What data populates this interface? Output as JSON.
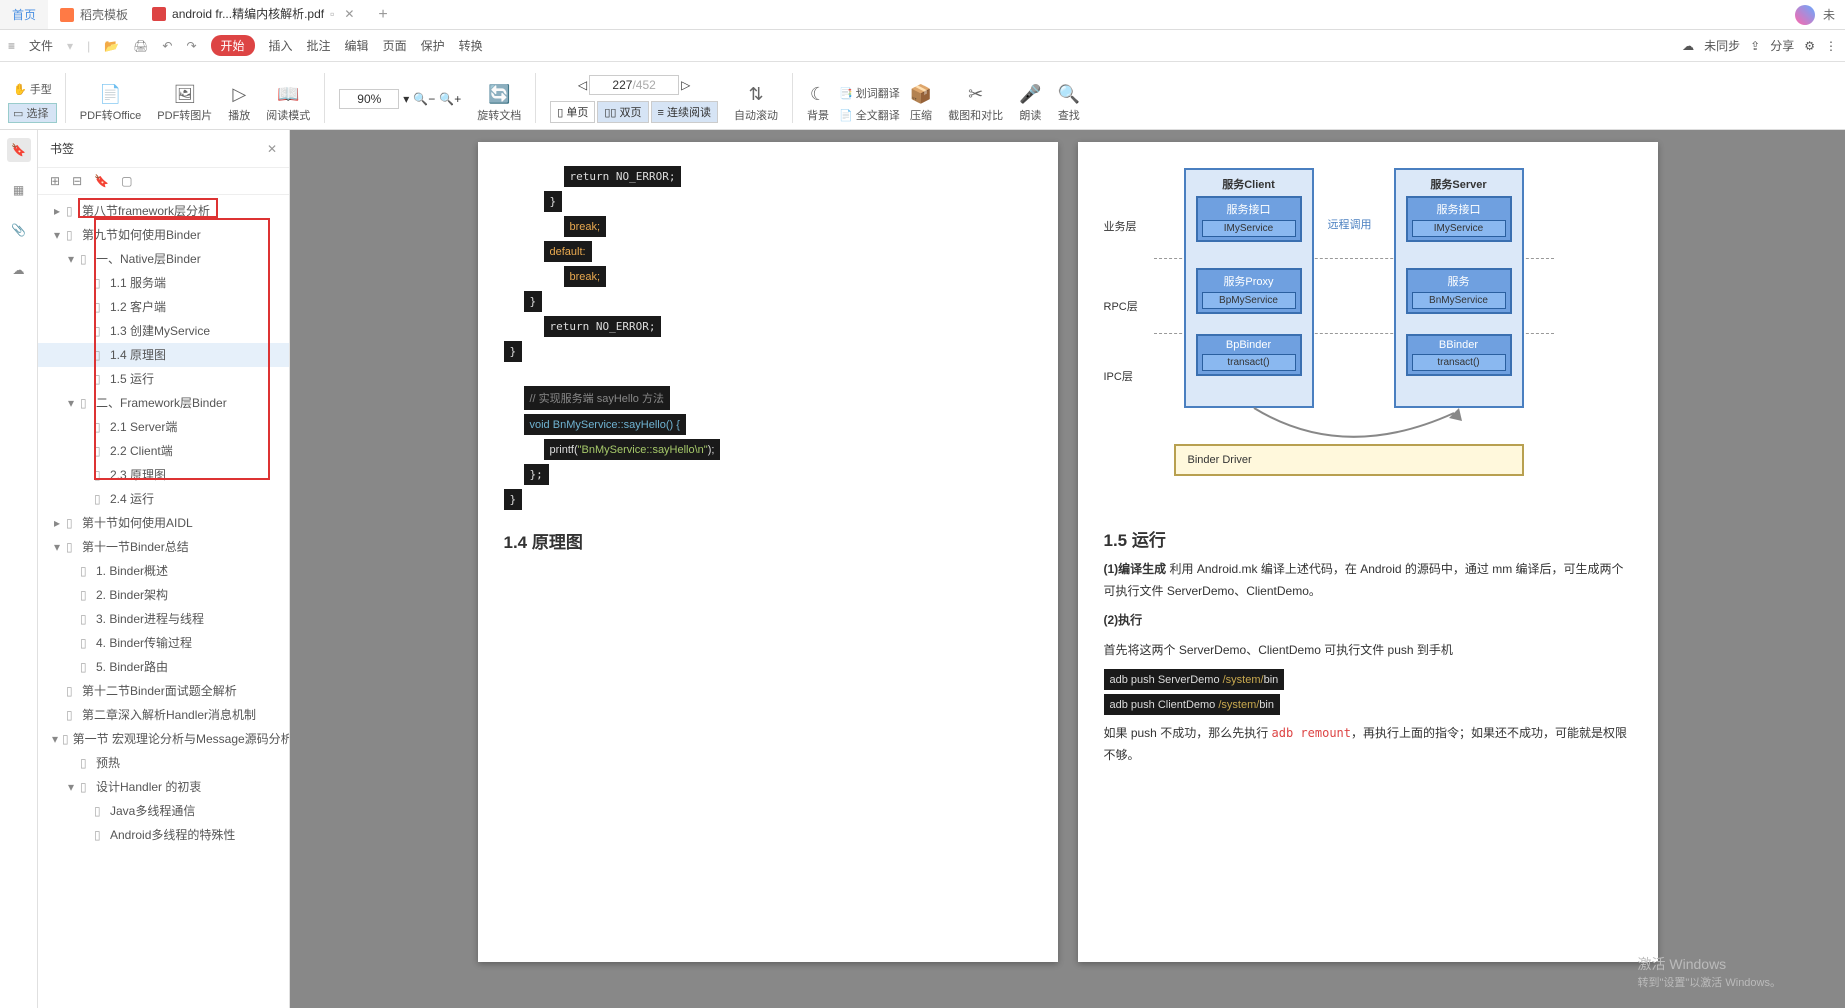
{
  "tabs": {
    "home": "首页",
    "docer": "稻壳模板",
    "active": "android fr...精编内核解析.pdf",
    "user": "未"
  },
  "menu": {
    "file": "文件",
    "start": "开始",
    "insert": "插入",
    "annot": "批注",
    "edit": "编辑",
    "page": "页面",
    "protect": "保护",
    "convert": "转换",
    "unsync": "未同步",
    "share": "分享"
  },
  "toolbar": {
    "hand": "手型",
    "select": "选择",
    "pdf2office": "PDF转Office",
    "pdf2img": "PDF转图片",
    "play": "播放",
    "readmode": "阅读模式",
    "zoom": "90%",
    "rotate": "旋转文档",
    "single": "单页",
    "double": "双页",
    "cont": "连续阅读",
    "autoscroll": "自动滚动",
    "bg": "背景",
    "trans": "划词翻译",
    "fulltrans": "全文翻译",
    "compress": "压缩",
    "crop": "截图和对比",
    "read": "朗读",
    "find": "查找",
    "page_current": "227",
    "page_total": "/452"
  },
  "sidebar": {
    "title": "书签",
    "items": [
      {
        "indent": 1,
        "toggle": "▸",
        "label": "第八节framework层分析"
      },
      {
        "indent": 1,
        "toggle": "▾",
        "label": "第九节如何使用Binder",
        "red": true
      },
      {
        "indent": 2,
        "toggle": "▾",
        "label": "一、Native层Binder"
      },
      {
        "indent": 3,
        "toggle": "",
        "label": "1.1 服务端"
      },
      {
        "indent": 3,
        "toggle": "",
        "label": "1.2 客户端"
      },
      {
        "indent": 3,
        "toggle": "",
        "label": "1.3 创建MyService"
      },
      {
        "indent": 3,
        "toggle": "",
        "label": "1.4 原理图",
        "selected": true
      },
      {
        "indent": 3,
        "toggle": "",
        "label": "1.5 运行"
      },
      {
        "indent": 2,
        "toggle": "▾",
        "label": "二、Framework层Binder"
      },
      {
        "indent": 3,
        "toggle": "",
        "label": "2.1 Server端"
      },
      {
        "indent": 3,
        "toggle": "",
        "label": "2.2 Client端"
      },
      {
        "indent": 3,
        "toggle": "",
        "label": "2.3 原理图"
      },
      {
        "indent": 3,
        "toggle": "",
        "label": "2.4 运行"
      },
      {
        "indent": 1,
        "toggle": "▸",
        "label": "第十节如何使用AIDL"
      },
      {
        "indent": 1,
        "toggle": "▾",
        "label": "第十一节Binder总结"
      },
      {
        "indent": 2,
        "toggle": "",
        "label": "1. Binder概述"
      },
      {
        "indent": 2,
        "toggle": "",
        "label": "2. Binder架构"
      },
      {
        "indent": 2,
        "toggle": "",
        "label": "3. Binder进程与线程"
      },
      {
        "indent": 2,
        "toggle": "",
        "label": "4. Binder传输过程"
      },
      {
        "indent": 2,
        "toggle": "",
        "label": "5. Binder路由"
      },
      {
        "indent": 1,
        "toggle": "",
        "label": "第十二节Binder面试题全解析"
      },
      {
        "indent": 1,
        "toggle": "",
        "label": "第二章深入解析Handler消息机制"
      },
      {
        "indent": 1,
        "toggle": "▾",
        "label": "第一节 宏观理论分析与Message源码分析"
      },
      {
        "indent": 2,
        "toggle": "",
        "label": "预热"
      },
      {
        "indent": 2,
        "toggle": "▾",
        "label": "设计Handler 的初衷"
      },
      {
        "indent": 3,
        "toggle": "",
        "label": "Java多线程通信"
      },
      {
        "indent": 3,
        "toggle": "",
        "label": "Android多线程的特殊性"
      }
    ]
  },
  "page_left": {
    "code1": "return NO_ERROR;",
    "code2": "}",
    "code3": "break;",
    "code4": "default:",
    "code5": "break;",
    "code6": "}",
    "code7": "return NO_ERROR;",
    "code8": "}",
    "code_comment": "// 实现服务端 sayHello 方法",
    "code_fn": "void BnMyService::sayHello() {",
    "code_printf_a": "printf(",
    "code_printf_b": "\"BnMyService::sayHello\\n\"",
    "code_printf_c": ");",
    "code_end1": "};",
    "code_end2": "}",
    "title": "1.4  原理图"
  },
  "page_right": {
    "diagram": {
      "client_title": "服务Client",
      "server_title": "服务Server",
      "svc_interface": "服务接口",
      "imysvc": "IMyService",
      "remote_call": "远程调用",
      "proxy": "服务Proxy",
      "bp_svc": "BpMyService",
      "svc": "服务",
      "bn_svc": "BnMyService",
      "bpbinder": "BpBinder",
      "transact": "transact()",
      "bbinder": "BBinder",
      "driver": "Binder Driver",
      "biz": "业务层",
      "rpc": "RPC层",
      "ipc": "IPC层"
    },
    "title": "1.5  运行",
    "p1a": "(1)编译生成",
    "p1b": " 利用 Android.mk 编译上述代码，在 Android 的源码中，通过 mm 编译后，可生成两个可执行文件 ServerDemo、ClientDemo。",
    "p2": "(2)执行",
    "p3": "首先将这两个 ServerDemo、ClientDemo 可执行文件 push 到手机",
    "cmd1_a": "adb push ServerDemo ",
    "cmd1_b": "/system/",
    "cmd1_c": "bin",
    "cmd2_a": "adb push ClientDemo ",
    "cmd2_b": "/system/",
    "cmd2_c": "bin",
    "p4a": "如果 push 不成功，那么先执行 ",
    "p4b": "adb remount",
    "p4c": "，再执行上面的指令；如果还不成功，可能就是权限不够。"
  },
  "watermark": {
    "l1": "激活 Windows",
    "l2": "转到\"设置\"以激活 Windows。"
  }
}
